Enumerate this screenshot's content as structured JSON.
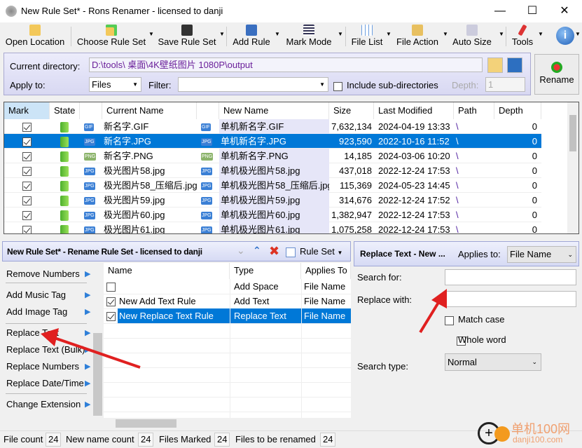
{
  "window": {
    "title": "New Rule Set* - Rons Renamer - licensed to danji",
    "minimize": "—",
    "maximize": "☐",
    "close": "✕"
  },
  "toolbar": {
    "items": [
      {
        "label": "Open Location",
        "icon": "folder-icon"
      },
      {
        "label": "Choose Rule Set",
        "icon": "folder-refresh-icon"
      },
      {
        "label": "Save Rule Set",
        "icon": "floppy-disk-icon"
      },
      {
        "label": "Add Rule",
        "icon": "add-document-icon"
      },
      {
        "label": "Mark Mode",
        "icon": "list-icon"
      },
      {
        "label": "File List",
        "icon": "grid-edit-icon"
      },
      {
        "label": "File Action",
        "icon": "folder-gear-icon"
      },
      {
        "label": "Auto Size",
        "icon": "resize-icon"
      },
      {
        "label": "Tools",
        "icon": "tools-icon"
      }
    ],
    "info": "i"
  },
  "directory": {
    "label": "Current directory:",
    "value": "D:\\tools\\ 桌面\\4K壁纸图片 1080P\\output",
    "apply_label": "Apply to:",
    "apply_value": "Files",
    "filter_label": "Filter:",
    "filter_value": "",
    "include_sub": "Include sub-directories",
    "depth_label": "Depth:",
    "depth_value": "1"
  },
  "rename_button": "Rename",
  "filelist": {
    "headers": [
      "Mark",
      "State",
      "",
      "Current Name",
      "",
      "New Name",
      "Size",
      "Last Modified",
      "Path",
      "Depth"
    ],
    "rows": [
      {
        "type": "GIF",
        "current": "新名字.GIF",
        "new": "单机新名字.GIF",
        "size": "7,632,134",
        "modified": "2024-04-19 13:33",
        "path": "\\",
        "depth": "0"
      },
      {
        "type": "JPG",
        "current": "新名字.JPG",
        "new": "单机新名字.JPG",
        "size": "923,590",
        "modified": "2022-10-16 11:52",
        "path": "\\",
        "depth": "0",
        "selected": true
      },
      {
        "type": "PNG",
        "current": "新名字.PNG",
        "new": "单机新名字.PNG",
        "size": "14,185",
        "modified": "2024-03-06 10:20",
        "path": "\\",
        "depth": "0"
      },
      {
        "type": "JPG",
        "current": "极光图片58.jpg",
        "new": "单机极光图片58.jpg",
        "size": "437,018",
        "modified": "2022-12-24 17:53",
        "path": "\\",
        "depth": "0"
      },
      {
        "type": "JPG",
        "current": "极光图片58_压缩后.jpg",
        "new": "单机极光图片58_压缩后.jpg",
        "size": "115,369",
        "modified": "2024-05-23 14:45",
        "path": "\\",
        "depth": "0"
      },
      {
        "type": "JPG",
        "current": "极光图片59.jpg",
        "new": "单机极光图片59.jpg",
        "size": "314,676",
        "modified": "2022-12-24 17:52",
        "path": "\\",
        "depth": "0"
      },
      {
        "type": "JPG",
        "current": "极光图片60.jpg",
        "new": "单机极光图片60.jpg",
        "size": "1,382,947",
        "modified": "2022-12-24 17:53",
        "path": "\\",
        "depth": "0"
      },
      {
        "type": "JPG",
        "current": "极光图片61.jpg",
        "new": "单机极光图片61.jpg",
        "size": "1,075,258",
        "modified": "2022-12-24 17:53",
        "path": "\\",
        "depth": "0"
      }
    ]
  },
  "ruleset": {
    "title": "New Rule Set* - Rename Rule Set - licensed to danji",
    "ruleset_button": "Rule Set",
    "available": [
      "Remove Numbers",
      "Add Music Tag",
      "Add Image Tag",
      "Replace Text",
      "Replace Text (Bulk)",
      "Replace Numbers",
      "Replace Date/Time",
      "Change Extension"
    ],
    "headers": [
      "Name",
      "Type",
      "Applies To"
    ],
    "rules": [
      {
        "checked": false,
        "name": "",
        "type": "Add Space",
        "applies": "File Name"
      },
      {
        "checked": true,
        "name": "New Add Text Rule",
        "type": "Add Text",
        "applies": "File Name"
      },
      {
        "checked": true,
        "name": "New Replace Text Rule",
        "type": "Replace Text",
        "applies": "File Name",
        "selected": true
      }
    ]
  },
  "rule_editor": {
    "title": "Replace Text - New ...",
    "applies_label": "Applies to:",
    "applies_value": "File Name",
    "search_label": "Search for:",
    "search_value": "",
    "replace_label": "Replace with:",
    "replace_value": "",
    "match_case": "Match case",
    "whole_word": "Whole word",
    "search_type_label": "Search type:",
    "search_type_value": "Normal"
  },
  "status": {
    "file_count_label": "File count",
    "file_count": "24",
    "new_name_label": "New name count",
    "new_name": "24",
    "marked_label": "Files Marked",
    "marked": "24",
    "rename_label": "Files to be renamed",
    "rename": "24"
  },
  "watermark": {
    "text": "单机100网",
    "sub": "danji100.com"
  },
  "colors": {
    "selection": "#0078d7",
    "new_name_bg": "#e6e6f8",
    "panel": "#dcdff4",
    "arrow": "#e02020"
  }
}
